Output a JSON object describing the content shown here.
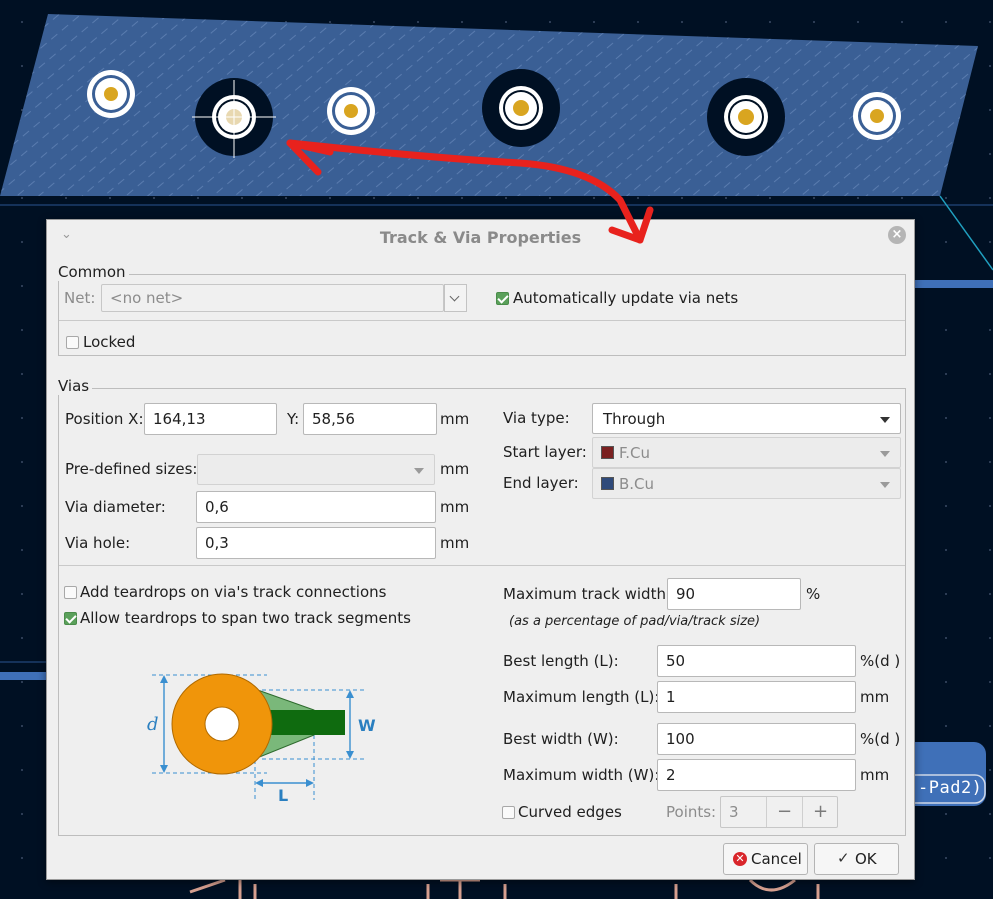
{
  "pcb": {
    "pad_label": "-Pad2)",
    "colors": {
      "background": "#001023",
      "zone": "#3a5f95",
      "via_ring": "#e8e8e8",
      "via_hole": "#d9a520",
      "arrow": "#e8221d"
    }
  },
  "dialog": {
    "title": "Track & Via Properties",
    "close_icon": "close-icon",
    "common": {
      "title": "Common",
      "net_label": "Net:",
      "net_value": "<no net>",
      "auto_update_label": "Automatically update via nets",
      "auto_update_checked": true,
      "locked_label": "Locked",
      "locked_checked": false
    },
    "vias": {
      "title": "Vias",
      "position_x_label": "Position X:",
      "position_x_value": "164,13",
      "y_label": "Y:",
      "y_value": "58,56",
      "unit_mm": "mm",
      "predefined_label": "Pre-defined sizes:",
      "predefined_value": "",
      "diameter_label": "Via diameter:",
      "diameter_value": "0,6",
      "hole_label": "Via hole:",
      "hole_value": "0,3",
      "via_type_label": "Via type:",
      "via_type_value": "Through",
      "start_layer_label": "Start layer:",
      "start_layer_value": "F.Cu",
      "start_layer_color": "#7a2020",
      "end_layer_label": "End layer:",
      "end_layer_value": "B.Cu",
      "end_layer_color": "#2f4a7a"
    },
    "teardrops": {
      "add_label": "Add teardrops on via's track connections",
      "add_checked": false,
      "span_label": "Allow teardrops to span two track segments",
      "span_checked": true,
      "max_track_width_label": "Maximum track width:",
      "max_track_width_value": "90",
      "percent_unit": "%",
      "note": "(as a percentage of pad/via/track size)",
      "best_length_label": "Best length (L):",
      "best_length_value": "50",
      "percent_d_unit": "%(d )",
      "max_length_label": "Maximum length (L):",
      "max_length_value": "1",
      "best_width_label": "Best width (W):",
      "best_width_value": "100",
      "max_width_label": "Maximum width (W):",
      "max_width_value": "2",
      "curved_label": "Curved edges",
      "curved_checked": false,
      "points_label": "Points:",
      "points_value": "3",
      "minus": "−",
      "plus": "+",
      "diagram_labels": {
        "d": "d",
        "w": "W",
        "l": "L"
      }
    },
    "buttons": {
      "cancel_label": "Cancel",
      "ok_label": "OK"
    }
  }
}
